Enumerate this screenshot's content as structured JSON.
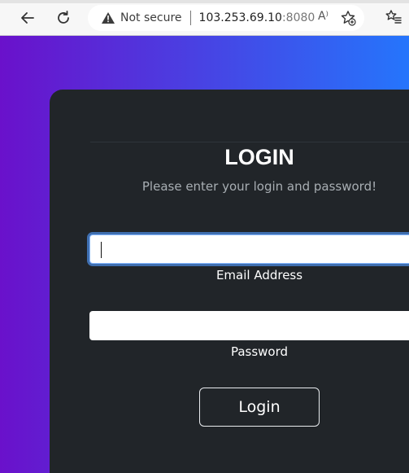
{
  "browser": {
    "security_label": "Not secure",
    "host": "103.253.69.10",
    "port": ":8080",
    "read_aloud": "A⁾"
  },
  "login": {
    "title": "LOGIN",
    "subtitle": "Please enter your login and password!",
    "email_label": "Email Address",
    "email_value": "",
    "password_label": "Password",
    "password_value": "",
    "button_label": "Login"
  },
  "colors": {
    "gradient_start": "#6a11cb",
    "gradient_end": "#2575fc",
    "card_bg": "#212529"
  },
  "icons": [
    "back-arrow-icon",
    "reload-icon",
    "warning-icon",
    "read-aloud-icon",
    "add-favorite-icon",
    "favorites-icon"
  ]
}
